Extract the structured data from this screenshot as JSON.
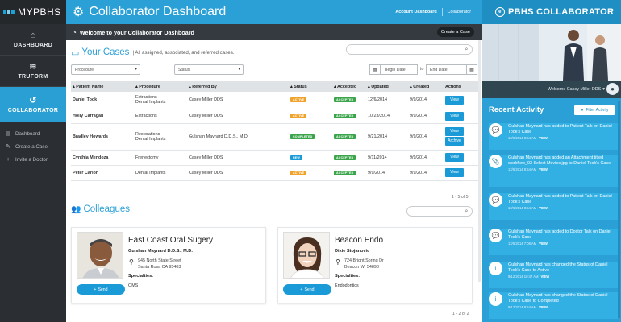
{
  "brand": {
    "logo_text": "MYPBHS"
  },
  "leftnav": {
    "items": [
      {
        "label": "DASHBOARD",
        "icon": "home-icon"
      },
      {
        "label": "TRUFORM",
        "icon": "truform-icon"
      },
      {
        "label": "COLLABORATOR",
        "icon": "collaborator-icon",
        "active": true
      }
    ],
    "subitems": [
      {
        "label": "Dashboard",
        "icon": "document-icon"
      },
      {
        "label": "Create a Case",
        "icon": "edit-icon"
      },
      {
        "label": "Invite a Doctor",
        "icon": "plus-icon"
      }
    ]
  },
  "header": {
    "title": "Collaborator Dashboard",
    "links": [
      "Account Dashboard",
      "Collaborator"
    ]
  },
  "welcome": {
    "text": "Welcome to your Collaborator Dashboard",
    "create_label": "Create a Case"
  },
  "cases": {
    "title": "Your Cases",
    "subtitle": "| All assigned, associated, and referred cases.",
    "filters": {
      "procedure": "Procedure",
      "status": "Status",
      "begin_date": "Begin Date",
      "to_label": "to",
      "end_date": "End Date"
    },
    "columns": [
      "Patient Name",
      "Procedure",
      "Referred By",
      "Status",
      "Accepted",
      "Updated",
      "Created",
      "Actions"
    ],
    "rows": [
      {
        "patient": "Daniel Took",
        "procedure": "Extractions\nDental Implants",
        "referred_by": "Casey Miller DDS",
        "status": "ACTIVE",
        "status_color": "#f0a32a",
        "accepted": "ACCEPTED",
        "updated": "12/6/2014",
        "created": "9/9/2014",
        "actions": [
          "View"
        ]
      },
      {
        "patient": "Holly Carragan",
        "procedure": "Extractions",
        "referred_by": "Casey Miller DDS",
        "status": "ACTIVE",
        "status_color": "#f0a32a",
        "accepted": "ACCEPTED",
        "updated": "10/23/2014",
        "created": "9/9/2014",
        "actions": [
          "View"
        ]
      },
      {
        "patient": "Bradley Howards",
        "procedure": "Restorations\nDental Implants",
        "referred_by": "Gulshan Maynard D.D.S., M.D.",
        "status": "COMPLETED",
        "status_color": "#3aa54b",
        "accepted": "ACCEPTED",
        "updated": "9/21/2014",
        "created": "9/9/2014",
        "actions": [
          "View",
          "Archive"
        ]
      },
      {
        "patient": "Cynthia Mendoza",
        "procedure": "Frenectomy",
        "referred_by": "Casey Miller DDS",
        "status": "NEW",
        "status_color": "#1a9ad6",
        "accepted": "ACCEPTED",
        "updated": "9/11/2014",
        "created": "9/9/2014",
        "actions": [
          "View"
        ]
      },
      {
        "patient": "Peter Carlon",
        "procedure": "Dental Implants",
        "referred_by": "Casey Miller DDS",
        "status": "ACTIVE",
        "status_color": "#f0a32a",
        "accepted": "ACCEPTED",
        "updated": "9/9/2014",
        "created": "9/9/2014",
        "actions": [
          "View"
        ]
      }
    ],
    "pager": "1 - 5 of 5"
  },
  "colleagues": {
    "title": "Colleagues",
    "cards": [
      {
        "practice": "East Coast Oral Sugery",
        "person": "Gulshan Maynard D.D.S., M.D.",
        "address1": "945 North State Street",
        "address2": "Santa Rosa CA 95403",
        "spec_label": "Specialties:",
        "specialty": "OMS",
        "send_label": "Send"
      },
      {
        "practice": "Beacon Endo",
        "person": "Dixie Stojanovic",
        "address1": "724 Bright Spring Dr",
        "address2": "Beacon WI 54898",
        "spec_label": "Specialties:",
        "specialty": "Endodontics",
        "send_label": "Send"
      }
    ],
    "pager": "1 - 2 of 2"
  },
  "right": {
    "brand": "PBHS COLLABORATOR",
    "welcome_user": "Welcome Casey Miller DDS",
    "recent_title": "Recent Activity",
    "filter_label": "Filter Activity",
    "activities": [
      {
        "icon": "chat-icon",
        "text": "Gulshan Maynard has added to Patient Talk on Daniel Took's Case",
        "time": "12/6/2014 8:54 AM",
        "view": "VIEW"
      },
      {
        "icon": "attachment-icon",
        "text": "Gulshan Maynard has added an Attachment titled workflow_03 Select Movies.jpg to Daniel Took's Case",
        "time": "12/6/2014 8:54 AM",
        "view": "VIEW"
      },
      {
        "icon": "chat-icon",
        "text": "Gulshan Maynard has added to Patient Talk on Daniel Took's Case",
        "time": "12/6/2014 8:54 AM",
        "view": "VIEW"
      },
      {
        "icon": "chat-icon",
        "text": "Gulshan Maynard has added to Doctor Talk on Daniel Took's Case",
        "time": "12/6/2014 7:06 AM",
        "view": "VIEW"
      },
      {
        "icon": "info-icon",
        "text": "Gulshan Maynard has changed the Status of Daniel Took's Case to Active",
        "time": "9/12/2014 10:47 AM",
        "view": "VIEW"
      },
      {
        "icon": "info-icon",
        "text": "Gulshan Maynard has changed the Status of Daniel Took's Case to Completed",
        "time": "9/12/2014 8:54 AM",
        "view": "VIEW"
      }
    ]
  }
}
